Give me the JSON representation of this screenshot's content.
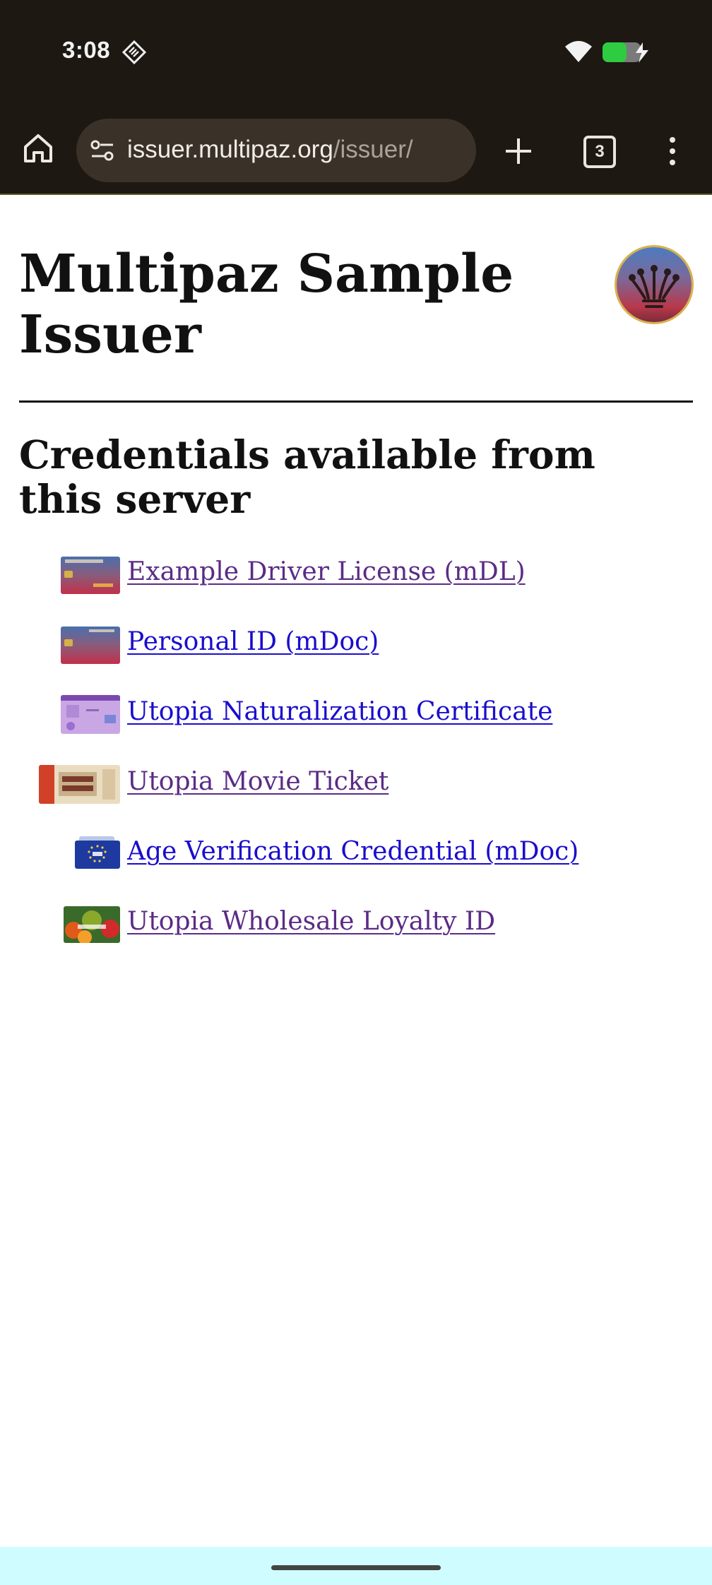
{
  "status_bar": {
    "time": "3:08",
    "icons": [
      "diamond-icon",
      "wifi-icon",
      "battery-charging-icon"
    ],
    "battery_color": "#2ecc40"
  },
  "browser": {
    "url_host": "issuer.multipaz.org",
    "url_path": "/issuer/",
    "tab_count": "3",
    "icons": [
      "home-icon",
      "tune-icon",
      "plus-icon",
      "tabs-icon",
      "more-vert-icon"
    ]
  },
  "page": {
    "title": "Multipaz Sample Issuer",
    "section_heading": "Credentials available from this server",
    "credentials": [
      {
        "label": "Example Driver License (mDL)",
        "visited": true,
        "icon": "driver-license-thumbnail"
      },
      {
        "label": "Personal ID (mDoc)",
        "visited": false,
        "icon": "personal-id-thumbnail"
      },
      {
        "label": "Utopia Naturalization Certificate",
        "visited": false,
        "icon": "naturalization-certificate-thumbnail"
      },
      {
        "label": "Utopia Movie Ticket",
        "visited": true,
        "icon": "movie-ticket-thumbnail"
      },
      {
        "label": "Age Verification Credential (mDoc)",
        "visited": false,
        "icon": "age-verification-thumbnail"
      },
      {
        "label": "Utopia Wholesale Loyalty ID",
        "visited": true,
        "icon": "loyalty-id-thumbnail"
      }
    ]
  },
  "colors": {
    "link_visited": "#5b2b86",
    "link_unvisited": "#1a0dcc",
    "browser_chrome": "#1d1812",
    "nav_bar": "#cffcff"
  }
}
